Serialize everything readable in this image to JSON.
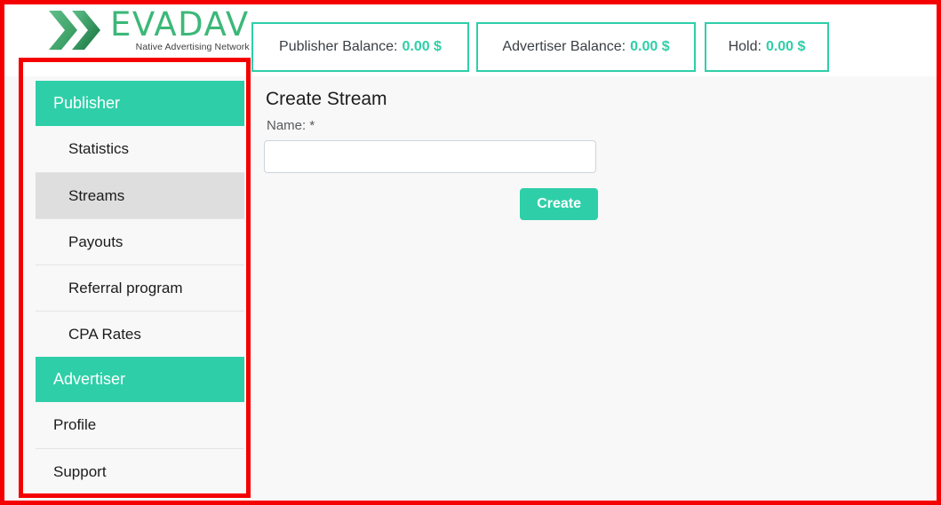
{
  "brand": {
    "logo_icon": "evadav-chevron-logo",
    "name": "EVADAV",
    "tagline": "Native Advertising Network",
    "accent_color": "#2ecfa8",
    "logo_green": "#3cb878",
    "annotation_color": "#f50000"
  },
  "header": {
    "balances": [
      {
        "label": "Publisher Balance:",
        "amount": "0.00 $"
      },
      {
        "label": "Advertiser Balance:",
        "amount": "0.00 $"
      },
      {
        "label": "Hold:",
        "amount": "0.00 $"
      }
    ]
  },
  "sidebar": {
    "items": [
      {
        "label": "Publisher",
        "type": "header",
        "active": false
      },
      {
        "label": "Statistics",
        "type": "sub",
        "active": false
      },
      {
        "label": "Streams",
        "type": "sub",
        "active": true
      },
      {
        "label": "Payouts",
        "type": "sub",
        "active": false
      },
      {
        "label": "Referral program",
        "type": "sub",
        "active": false
      },
      {
        "label": "CPA Rates",
        "type": "sub",
        "active": false
      },
      {
        "label": "Advertiser",
        "type": "header",
        "active": false
      },
      {
        "label": "Profile",
        "type": "top",
        "active": false
      },
      {
        "label": "Support",
        "type": "top",
        "active": false
      }
    ]
  },
  "main": {
    "title": "Create Stream",
    "form": {
      "name_label": "Name: *",
      "name_value": "",
      "name_placeholder": "",
      "submit_label": "Create"
    }
  }
}
